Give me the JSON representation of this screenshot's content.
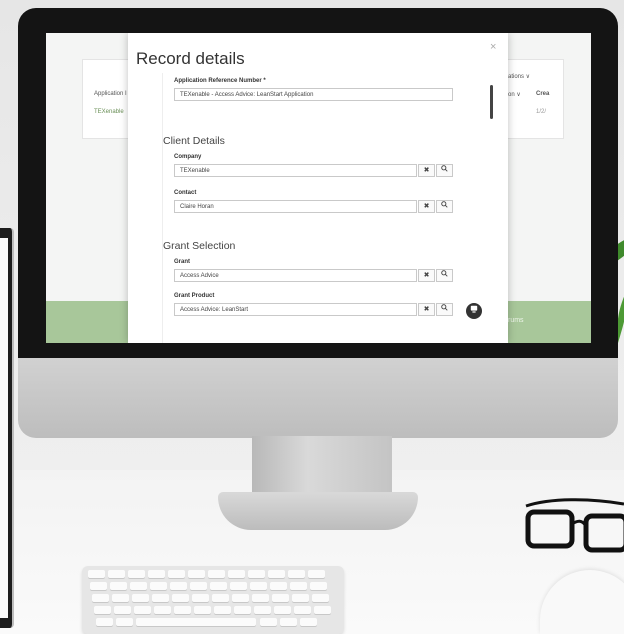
{
  "modal": {
    "title": "Record details",
    "close_icon": "×",
    "fields": {
      "app_ref_label": "Application Reference Number *",
      "app_ref_value": "TEXenable - Access Advice: LeanStart Application"
    },
    "client_details": {
      "heading": "Client Details",
      "company_label": "Company",
      "company_value": "TEXenable",
      "contact_label": "Contact",
      "contact_value": "Claire Horan"
    },
    "grant_selection": {
      "heading": "Grant Selection",
      "grant_label": "Grant",
      "grant_value": "Access Advice",
      "grant_product_label": "Grant Product",
      "grant_product_value": "Access Advice: LeanStart"
    },
    "clear_icon": "✖",
    "search_icon": "🔍"
  },
  "background_page": {
    "col_header": "Application I",
    "row_value": "TEXenable",
    "right_top": "ations ∨",
    "right_col": "on ∨",
    "right_col2": "Crea",
    "right_row": "1/2/",
    "footer_text": "rums"
  },
  "colors": {
    "accent_green": "#a8c79a",
    "link_green": "#6a8f57"
  }
}
